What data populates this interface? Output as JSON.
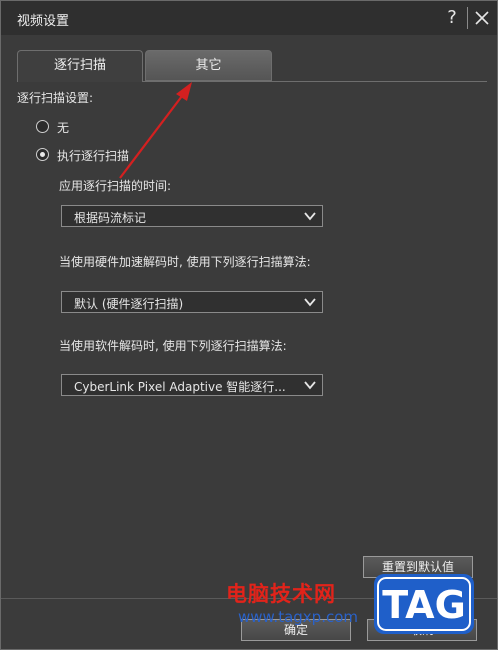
{
  "window": {
    "title": "视频设置",
    "help_label": "?"
  },
  "tabs": [
    {
      "label": "逐行扫描"
    },
    {
      "label": "其它"
    }
  ],
  "section": {
    "label": "逐行扫描设置:"
  },
  "radios": [
    {
      "label": "无",
      "checked": false
    },
    {
      "label": "执行逐行扫描",
      "checked": true
    }
  ],
  "fields": [
    {
      "label": "应用逐行扫描的时间:",
      "value": "根据码流标记"
    },
    {
      "label": "当使用硬件加速解码时, 使用下列逐行扫描算法:",
      "value": "默认 (硬件逐行扫描)"
    },
    {
      "label": "当使用软件解码时, 使用下列逐行扫描算法:",
      "value": "CyberLink Pixel Adaptive 智能逐行..."
    }
  ],
  "buttons": {
    "reset": "重置到默认值",
    "ok": "确定",
    "cancel": "取消"
  },
  "watermark": {
    "text": "电脑技术网",
    "url": "www.tagxp.com",
    "logo": "TAG"
  },
  "colors": {
    "annotation_arrow": "#d42020",
    "watermark_red": "#e2231a",
    "watermark_blue": "#1f5fc9"
  }
}
